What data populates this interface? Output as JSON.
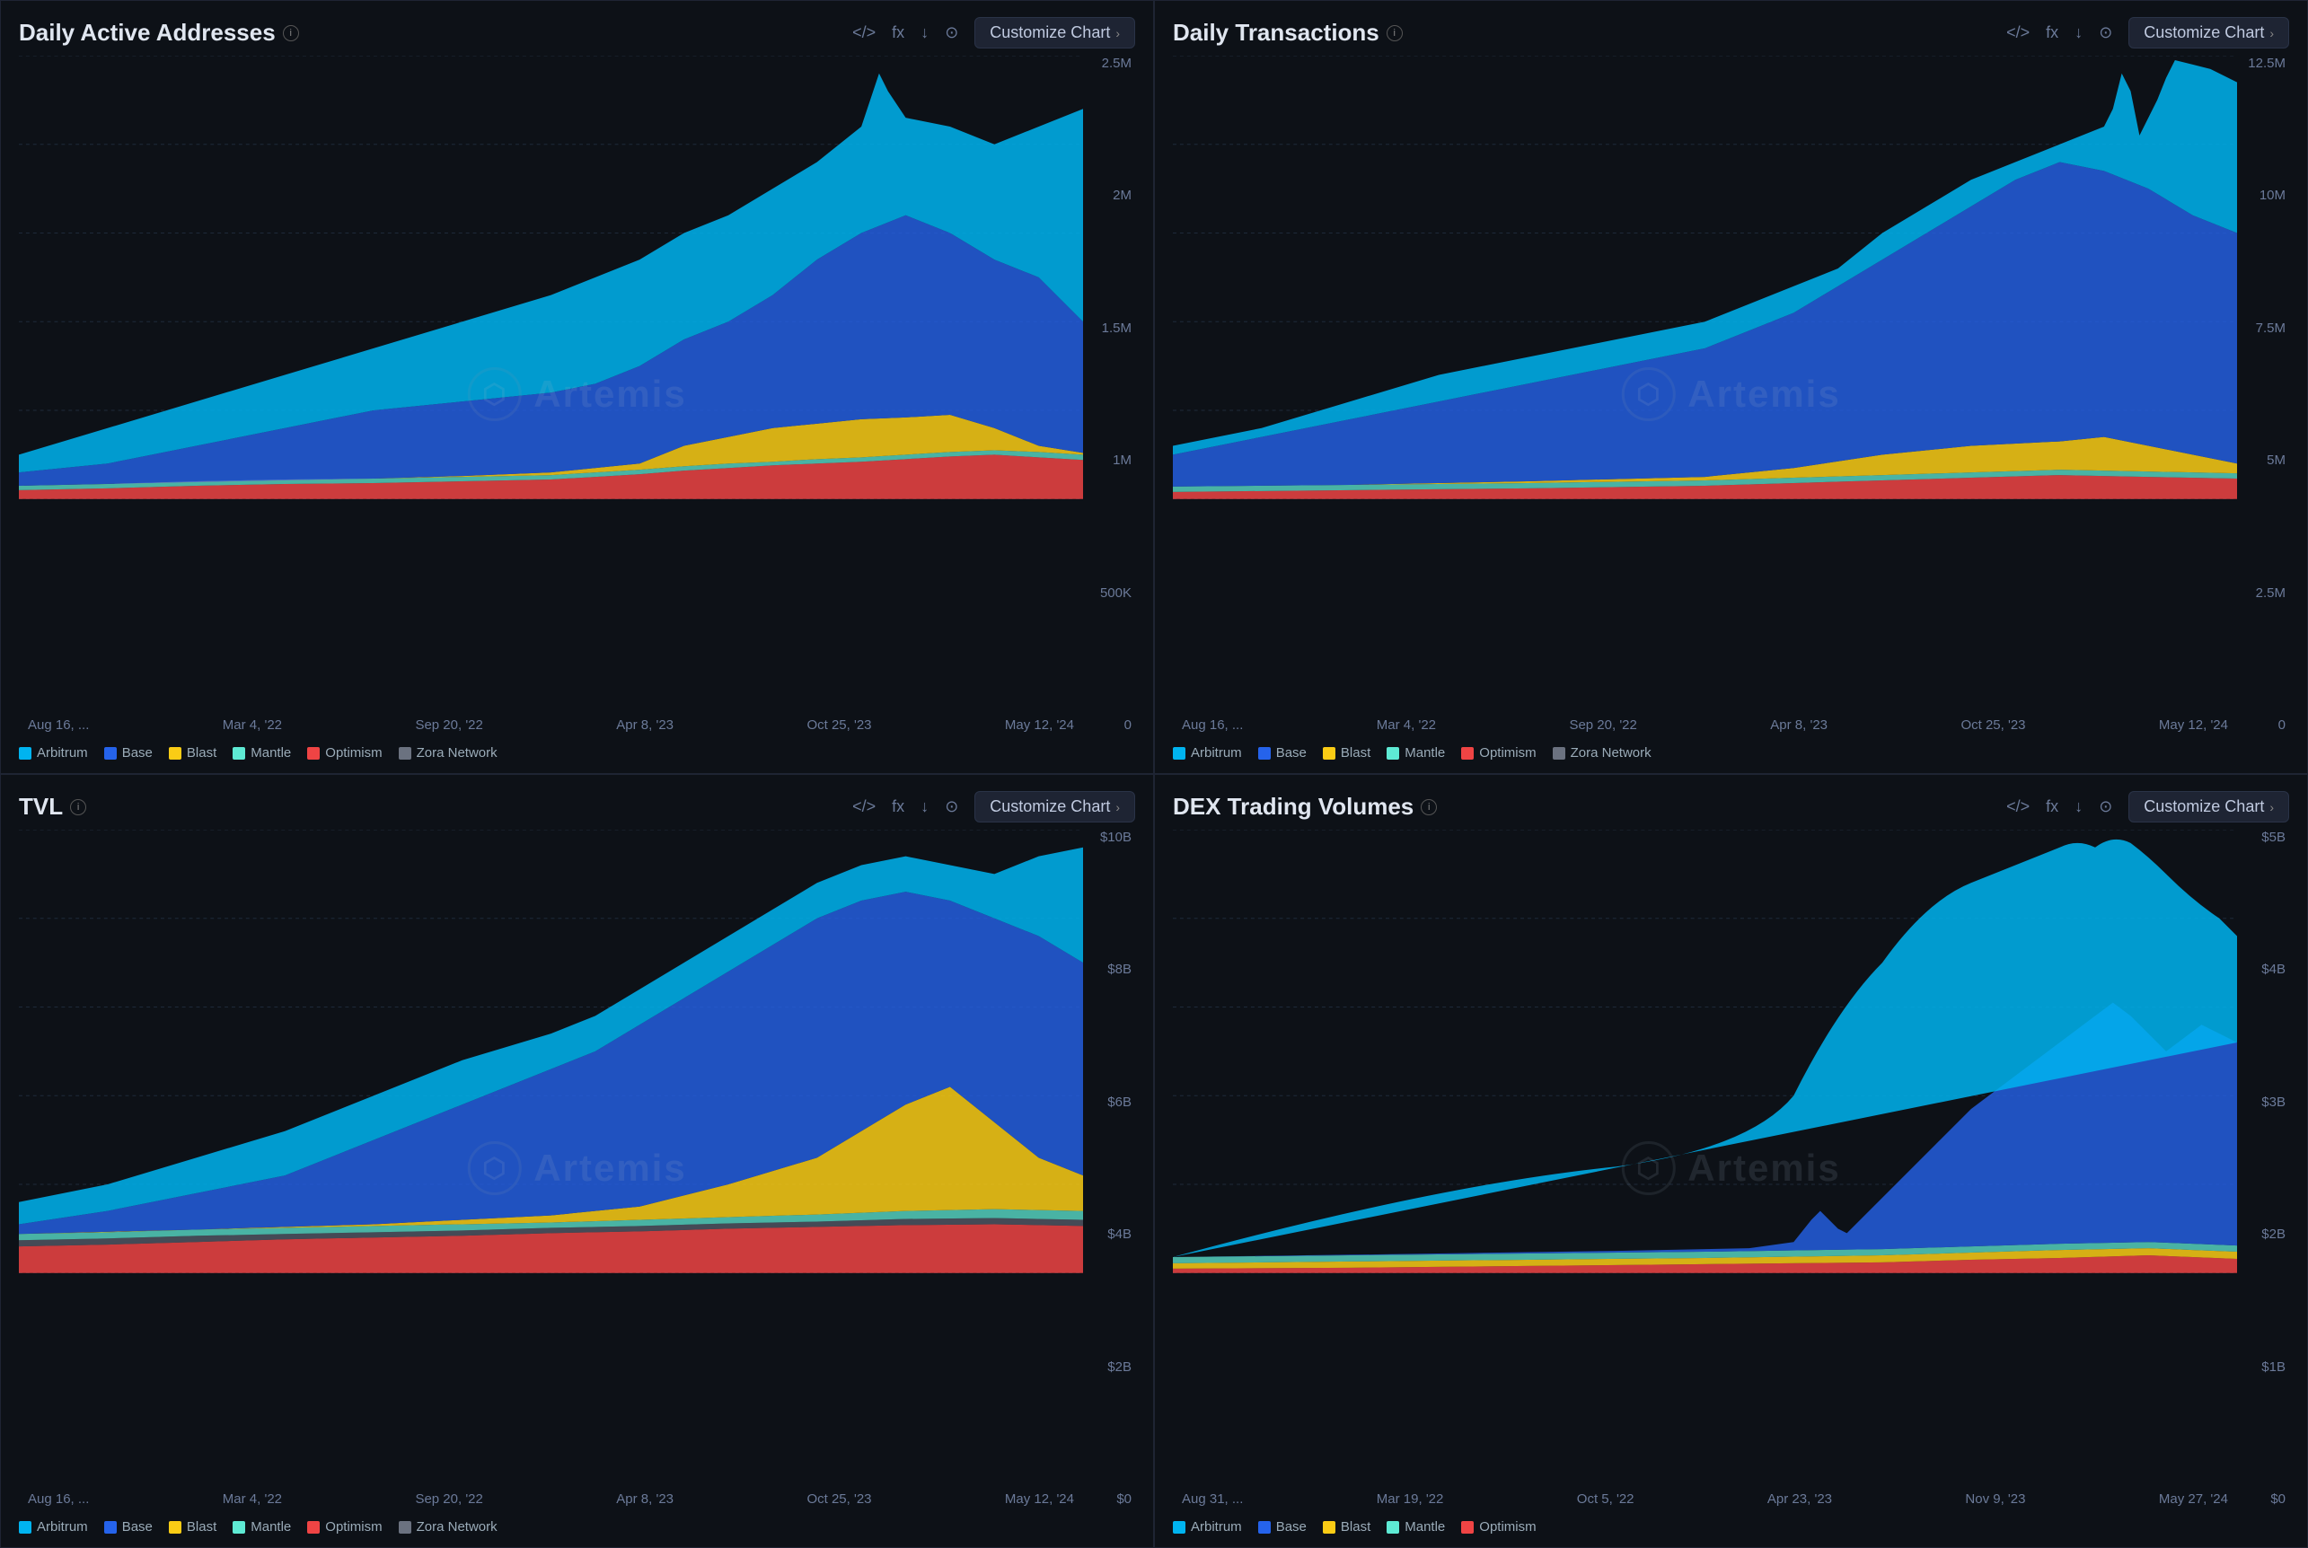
{
  "panels": [
    {
      "id": "daily-active-addresses",
      "title": "Daily Active Addresses",
      "customize_label": "Customize Chart",
      "yLabels": [
        "2.5M",
        "2M",
        "1.5M",
        "1M",
        "500K",
        "0"
      ],
      "xLabels": [
        "Aug 16, ...",
        "Mar 4, '22",
        "Sep 20, '22",
        "Apr 8, '23",
        "Oct 25, '23",
        "May 12, '24"
      ],
      "legend": [
        {
          "name": "Arbitrum",
          "color": "#00b4f0"
        },
        {
          "name": "Base",
          "color": "#2563eb"
        },
        {
          "name": "Blast",
          "color": "#facc15"
        },
        {
          "name": "Mantle",
          "color": "#5eead4"
        },
        {
          "name": "Optimism",
          "color": "#ef4444"
        },
        {
          "name": "Zora Network",
          "color": "#6b7280"
        }
      ]
    },
    {
      "id": "daily-transactions",
      "title": "Daily Transactions",
      "customize_label": "Customize Chart",
      "yLabels": [
        "12.5M",
        "10M",
        "7.5M",
        "5M",
        "2.5M",
        "0"
      ],
      "xLabels": [
        "Aug 16, ...",
        "Mar 4, '22",
        "Sep 20, '22",
        "Apr 8, '23",
        "Oct 25, '23",
        "May 12, '24"
      ],
      "legend": [
        {
          "name": "Arbitrum",
          "color": "#00b4f0"
        },
        {
          "name": "Base",
          "color": "#2563eb"
        },
        {
          "name": "Blast",
          "color": "#facc15"
        },
        {
          "name": "Mantle",
          "color": "#5eead4"
        },
        {
          "name": "Optimism",
          "color": "#ef4444"
        },
        {
          "name": "Zora Network",
          "color": "#6b7280"
        }
      ]
    },
    {
      "id": "tvl",
      "title": "TVL",
      "customize_label": "Customize Chart",
      "yLabels": [
        "$10B",
        "$8B",
        "$6B",
        "$4B",
        "$2B",
        "$0"
      ],
      "xLabels": [
        "Aug 16, ...",
        "Mar 4, '22",
        "Sep 20, '22",
        "Apr 8, '23",
        "Oct 25, '23",
        "May 12, '24"
      ],
      "legend": [
        {
          "name": "Arbitrum",
          "color": "#00b4f0"
        },
        {
          "name": "Base",
          "color": "#2563eb"
        },
        {
          "name": "Blast",
          "color": "#facc15"
        },
        {
          "name": "Mantle",
          "color": "#5eead4"
        },
        {
          "name": "Optimism",
          "color": "#ef4444"
        },
        {
          "name": "Zora Network",
          "color": "#6b7280"
        }
      ]
    },
    {
      "id": "dex-trading-volumes",
      "title": "DEX Trading Volumes",
      "customize_label": "Customize Chart",
      "yLabels": [
        "$5B",
        "$4B",
        "$3B",
        "$2B",
        "$1B",
        "$0"
      ],
      "xLabels": [
        "Aug 31, ...",
        "Mar 19, '22",
        "Oct 5, '22",
        "Apr 23, '23",
        "Nov 9, '23",
        "May 27, '24"
      ],
      "legend": [
        {
          "name": "Arbitrum",
          "color": "#00b4f0"
        },
        {
          "name": "Base",
          "color": "#2563eb"
        },
        {
          "name": "Blast",
          "color": "#facc15"
        },
        {
          "name": "Mantle",
          "color": "#5eead4"
        },
        {
          "name": "Optimism",
          "color": "#ef4444"
        }
      ]
    }
  ],
  "watermark": {
    "logo_char": "⬡",
    "text": "Artemis"
  },
  "icons": {
    "code": "</>",
    "fx": "fx",
    "download": "↓",
    "camera": "⊙",
    "info": "i",
    "chevron": "›"
  }
}
